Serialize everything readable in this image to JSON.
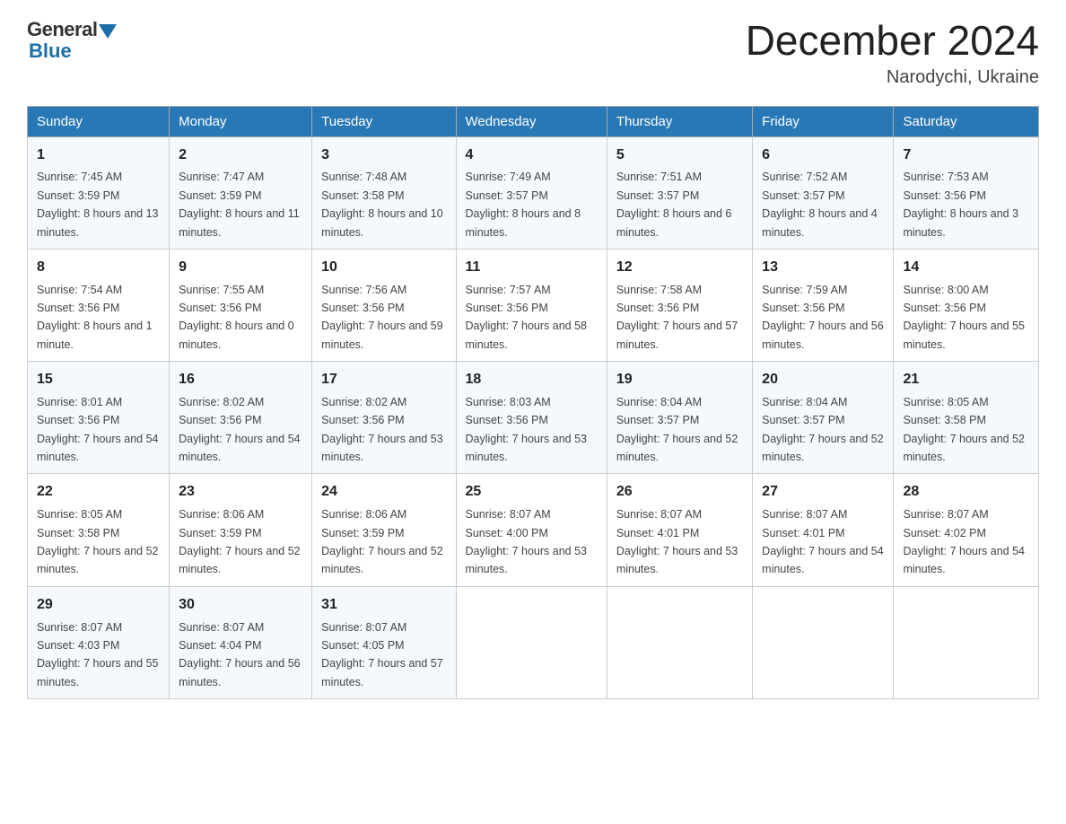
{
  "logo": {
    "general": "General",
    "blue": "Blue"
  },
  "title": "December 2024",
  "subtitle": "Narodychi, Ukraine",
  "days_of_week": [
    "Sunday",
    "Monday",
    "Tuesday",
    "Wednesday",
    "Thursday",
    "Friday",
    "Saturday"
  ],
  "weeks": [
    [
      {
        "day": "1",
        "sunrise": "7:45 AM",
        "sunset": "3:59 PM",
        "daylight": "8 hours and 13 minutes."
      },
      {
        "day": "2",
        "sunrise": "7:47 AM",
        "sunset": "3:59 PM",
        "daylight": "8 hours and 11 minutes."
      },
      {
        "day": "3",
        "sunrise": "7:48 AM",
        "sunset": "3:58 PM",
        "daylight": "8 hours and 10 minutes."
      },
      {
        "day": "4",
        "sunrise": "7:49 AM",
        "sunset": "3:57 PM",
        "daylight": "8 hours and 8 minutes."
      },
      {
        "day": "5",
        "sunrise": "7:51 AM",
        "sunset": "3:57 PM",
        "daylight": "8 hours and 6 minutes."
      },
      {
        "day": "6",
        "sunrise": "7:52 AM",
        "sunset": "3:57 PM",
        "daylight": "8 hours and 4 minutes."
      },
      {
        "day": "7",
        "sunrise": "7:53 AM",
        "sunset": "3:56 PM",
        "daylight": "8 hours and 3 minutes."
      }
    ],
    [
      {
        "day": "8",
        "sunrise": "7:54 AM",
        "sunset": "3:56 PM",
        "daylight": "8 hours and 1 minute."
      },
      {
        "day": "9",
        "sunrise": "7:55 AM",
        "sunset": "3:56 PM",
        "daylight": "8 hours and 0 minutes."
      },
      {
        "day": "10",
        "sunrise": "7:56 AM",
        "sunset": "3:56 PM",
        "daylight": "7 hours and 59 minutes."
      },
      {
        "day": "11",
        "sunrise": "7:57 AM",
        "sunset": "3:56 PM",
        "daylight": "7 hours and 58 minutes."
      },
      {
        "day": "12",
        "sunrise": "7:58 AM",
        "sunset": "3:56 PM",
        "daylight": "7 hours and 57 minutes."
      },
      {
        "day": "13",
        "sunrise": "7:59 AM",
        "sunset": "3:56 PM",
        "daylight": "7 hours and 56 minutes."
      },
      {
        "day": "14",
        "sunrise": "8:00 AM",
        "sunset": "3:56 PM",
        "daylight": "7 hours and 55 minutes."
      }
    ],
    [
      {
        "day": "15",
        "sunrise": "8:01 AM",
        "sunset": "3:56 PM",
        "daylight": "7 hours and 54 minutes."
      },
      {
        "day": "16",
        "sunrise": "8:02 AM",
        "sunset": "3:56 PM",
        "daylight": "7 hours and 54 minutes."
      },
      {
        "day": "17",
        "sunrise": "8:02 AM",
        "sunset": "3:56 PM",
        "daylight": "7 hours and 53 minutes."
      },
      {
        "day": "18",
        "sunrise": "8:03 AM",
        "sunset": "3:56 PM",
        "daylight": "7 hours and 53 minutes."
      },
      {
        "day": "19",
        "sunrise": "8:04 AM",
        "sunset": "3:57 PM",
        "daylight": "7 hours and 52 minutes."
      },
      {
        "day": "20",
        "sunrise": "8:04 AM",
        "sunset": "3:57 PM",
        "daylight": "7 hours and 52 minutes."
      },
      {
        "day": "21",
        "sunrise": "8:05 AM",
        "sunset": "3:58 PM",
        "daylight": "7 hours and 52 minutes."
      }
    ],
    [
      {
        "day": "22",
        "sunrise": "8:05 AM",
        "sunset": "3:58 PM",
        "daylight": "7 hours and 52 minutes."
      },
      {
        "day": "23",
        "sunrise": "8:06 AM",
        "sunset": "3:59 PM",
        "daylight": "7 hours and 52 minutes."
      },
      {
        "day": "24",
        "sunrise": "8:06 AM",
        "sunset": "3:59 PM",
        "daylight": "7 hours and 52 minutes."
      },
      {
        "day": "25",
        "sunrise": "8:07 AM",
        "sunset": "4:00 PM",
        "daylight": "7 hours and 53 minutes."
      },
      {
        "day": "26",
        "sunrise": "8:07 AM",
        "sunset": "4:01 PM",
        "daylight": "7 hours and 53 minutes."
      },
      {
        "day": "27",
        "sunrise": "8:07 AM",
        "sunset": "4:01 PM",
        "daylight": "7 hours and 54 minutes."
      },
      {
        "day": "28",
        "sunrise": "8:07 AM",
        "sunset": "4:02 PM",
        "daylight": "7 hours and 54 minutes."
      }
    ],
    [
      {
        "day": "29",
        "sunrise": "8:07 AM",
        "sunset": "4:03 PM",
        "daylight": "7 hours and 55 minutes."
      },
      {
        "day": "30",
        "sunrise": "8:07 AM",
        "sunset": "4:04 PM",
        "daylight": "7 hours and 56 minutes."
      },
      {
        "day": "31",
        "sunrise": "8:07 AM",
        "sunset": "4:05 PM",
        "daylight": "7 hours and 57 minutes."
      },
      null,
      null,
      null,
      null
    ]
  ]
}
